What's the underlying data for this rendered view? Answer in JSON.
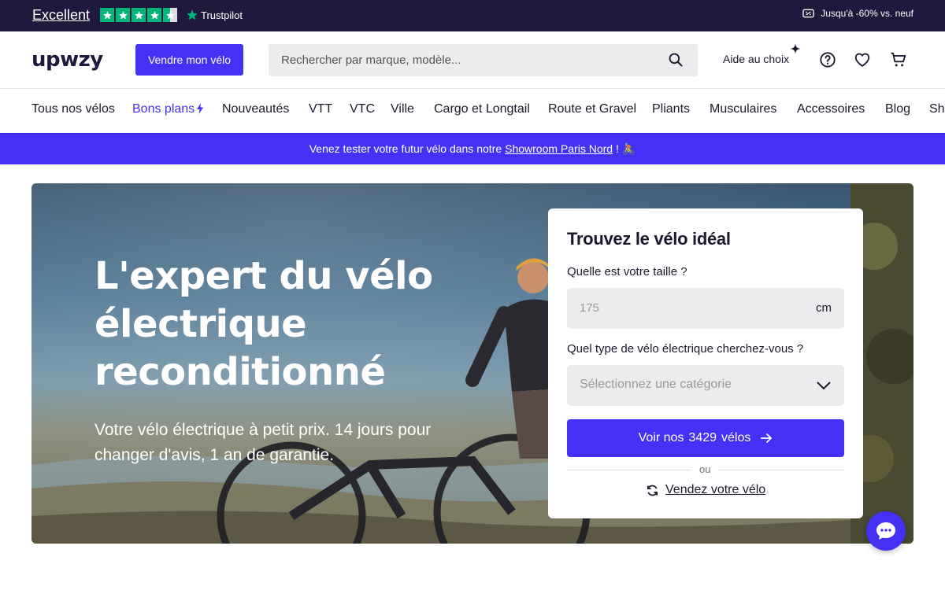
{
  "topbar": {
    "rating_label": "Excellent",
    "trustpilot_label": "Trustpilot",
    "promo_text": "Jusqu'à -60% vs. neuf"
  },
  "header": {
    "logo_text": "upwzy",
    "sell_button": "Vendre mon vélo",
    "search_placeholder": "Rechercher par marque, modèle...",
    "help_label": "Aide au choix"
  },
  "nav": {
    "items": [
      "Tous nos vélos",
      "Bons plans",
      "Nouveautés",
      "VTT",
      "VTC",
      "Ville",
      "Cargo et Longtail",
      "Route et Gravel",
      "Pliants",
      "Musculaires",
      "Accessoires",
      "Blog",
      "Sh"
    ]
  },
  "banner": {
    "text_before": "Venez tester votre futur vélo dans notre",
    "link": "Showroom Paris Nord",
    "text_after": "! 🚴"
  },
  "hero": {
    "title": "L'expert du vélo électrique reconditionné",
    "subtitle": "Votre vélo électrique à petit prix. 14 jours pour changer d'avis, 1 an de garantie."
  },
  "finder": {
    "title": "Trouvez le vélo idéal",
    "size_label": "Quelle est votre taille ?",
    "size_placeholder": "175",
    "size_unit": "cm",
    "type_label": "Quel type de vélo électrique cherchez-vous ?",
    "type_placeholder": "Sélectionnez une catégorie",
    "cta_prefix": "Voir nos",
    "cta_count": "3429",
    "cta_suffix": "vélos",
    "divider": "ou",
    "sell_link": "Vendez votre vélo"
  },
  "colors": {
    "brand": "#4531f5",
    "topbar": "#1f1a3d",
    "trustpilot_green": "#00b67a"
  },
  "icons": [
    "star-icon",
    "trustpilot-star-icon",
    "tag-icon",
    "search-icon",
    "sparkle-icon",
    "help-icon",
    "heart-icon",
    "cart-icon",
    "bolt-icon",
    "chevron-down-icon",
    "arrow-right-icon",
    "refresh-icon",
    "chat-icon"
  ]
}
